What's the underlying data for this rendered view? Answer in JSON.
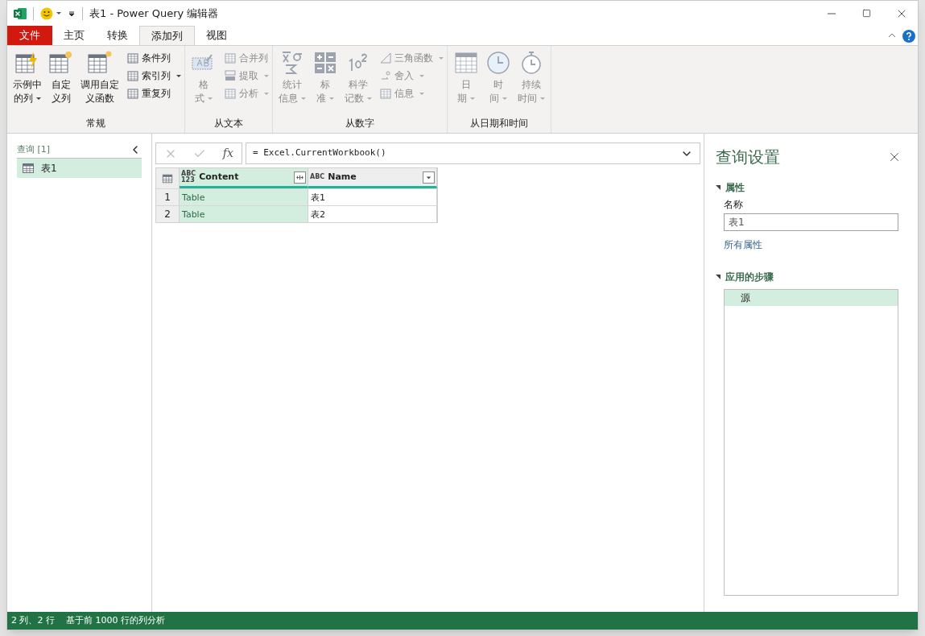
{
  "window": {
    "title": "表1 - Power Query 编辑器"
  },
  "tabs": [
    {
      "label": "文件",
      "kind": "file",
      "selected": false
    },
    {
      "label": "主页",
      "kind": "tab",
      "selected": false
    },
    {
      "label": "转换",
      "kind": "tab",
      "selected": false
    },
    {
      "label": "添加列",
      "kind": "tab",
      "selected": true
    },
    {
      "label": "视图",
      "kind": "tab",
      "selected": false
    }
  ],
  "ribbon_groups": [
    {
      "label": "常规",
      "large": [
        {
          "lines": [
            "示例中",
            "的列"
          ],
          "dropdown": true,
          "disabled": false
        },
        {
          "lines": [
            "自定",
            "义列"
          ],
          "dropdown": false,
          "disabled": false
        },
        {
          "lines": [
            "调用自定",
            "义函数"
          ],
          "dropdown": false,
          "disabled": false
        }
      ],
      "small": [
        {
          "label": "条件列",
          "dropdown": false,
          "disabled": false
        },
        {
          "label": "索引列",
          "dropdown": true,
          "disabled": false
        },
        {
          "label": "重复列",
          "dropdown": false,
          "disabled": false
        }
      ]
    },
    {
      "label": "从文本",
      "large": [
        {
          "lines": [
            "格",
            "式"
          ],
          "dropdown": true,
          "disabled": true
        }
      ],
      "small": [
        {
          "label": "合并列",
          "dropdown": false,
          "disabled": true
        },
        {
          "label": "提取",
          "dropdown": true,
          "disabled": true
        },
        {
          "label": "分析",
          "dropdown": true,
          "disabled": true
        }
      ]
    },
    {
      "label": "从数字",
      "large": [
        {
          "lines": [
            "统计",
            "信息"
          ],
          "dropdown": true,
          "disabled": true
        },
        {
          "lines": [
            "标",
            "准"
          ],
          "dropdown": true,
          "disabled": true
        },
        {
          "lines": [
            "科学",
            "记数"
          ],
          "dropdown": true,
          "disabled": true
        }
      ],
      "small": [
        {
          "label": "三角函数",
          "dropdown": true,
          "disabled": true
        },
        {
          "label": "舍入",
          "dropdown": true,
          "disabled": true
        },
        {
          "label": "信息",
          "dropdown": true,
          "disabled": true
        }
      ]
    },
    {
      "label": "从日期和时间",
      "large": [
        {
          "lines": [
            "日",
            "期"
          ],
          "dropdown": true,
          "disabled": true
        },
        {
          "lines": [
            "时",
            "间"
          ],
          "dropdown": true,
          "disabled": true
        },
        {
          "lines": [
            "持续",
            "时间"
          ],
          "dropdown": true,
          "disabled": true
        }
      ]
    }
  ],
  "queries": {
    "header": "查询 [1]",
    "items": [
      {
        "label": "表1",
        "selected": true
      }
    ]
  },
  "formula": {
    "fx_label": "fx",
    "value": "= Excel.CurrentWorkbook()"
  },
  "table": {
    "columns": [
      {
        "name": "Content",
        "type_label": "ABC\n123",
        "selected": true
      },
      {
        "name": "Name",
        "type_label": "ABC",
        "selected": false
      }
    ],
    "rows": [
      {
        "number": "1",
        "cells": [
          "Table",
          "表1"
        ]
      },
      {
        "number": "2",
        "cells": [
          "Table",
          "表2"
        ]
      }
    ]
  },
  "settings": {
    "title": "查询设置",
    "properties": {
      "header": "属性",
      "name_label": "名称",
      "name_value": "表1",
      "all_link": "所有属性"
    },
    "steps": {
      "header": "应用的步骤",
      "items": [
        {
          "label": "源",
          "selected": true
        }
      ]
    }
  },
  "status_bar": {
    "items": [
      "2 列、2 行",
      "基于前 1000 行的列分析"
    ]
  }
}
